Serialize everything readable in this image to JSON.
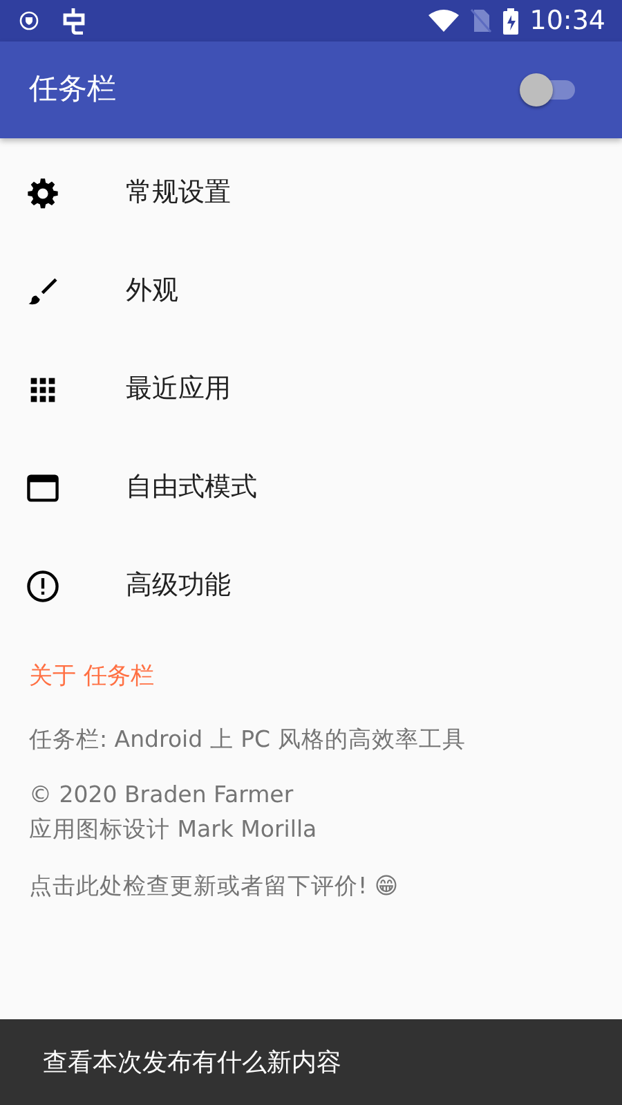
{
  "status_bar": {
    "time": "10:34"
  },
  "toolbar": {
    "title": "任务栏",
    "switch": {
      "on": false
    }
  },
  "menu": [
    {
      "label": "常规设置"
    },
    {
      "label": "外观"
    },
    {
      "label": "最近应用"
    },
    {
      "label": "自由式模式"
    },
    {
      "label": "高级功能"
    }
  ],
  "about": {
    "heading": "关于 任务栏",
    "description": "任务栏: Android 上 PC 风格的高效率工具",
    "credits": [
      "© 2020 Braden Farmer",
      "应用图标设计 Mark Morilla"
    ],
    "link": "点击此处检查更新或者留下评价! 😁"
  },
  "snackbar": {
    "message": "查看本次发布有什么新内容"
  }
}
